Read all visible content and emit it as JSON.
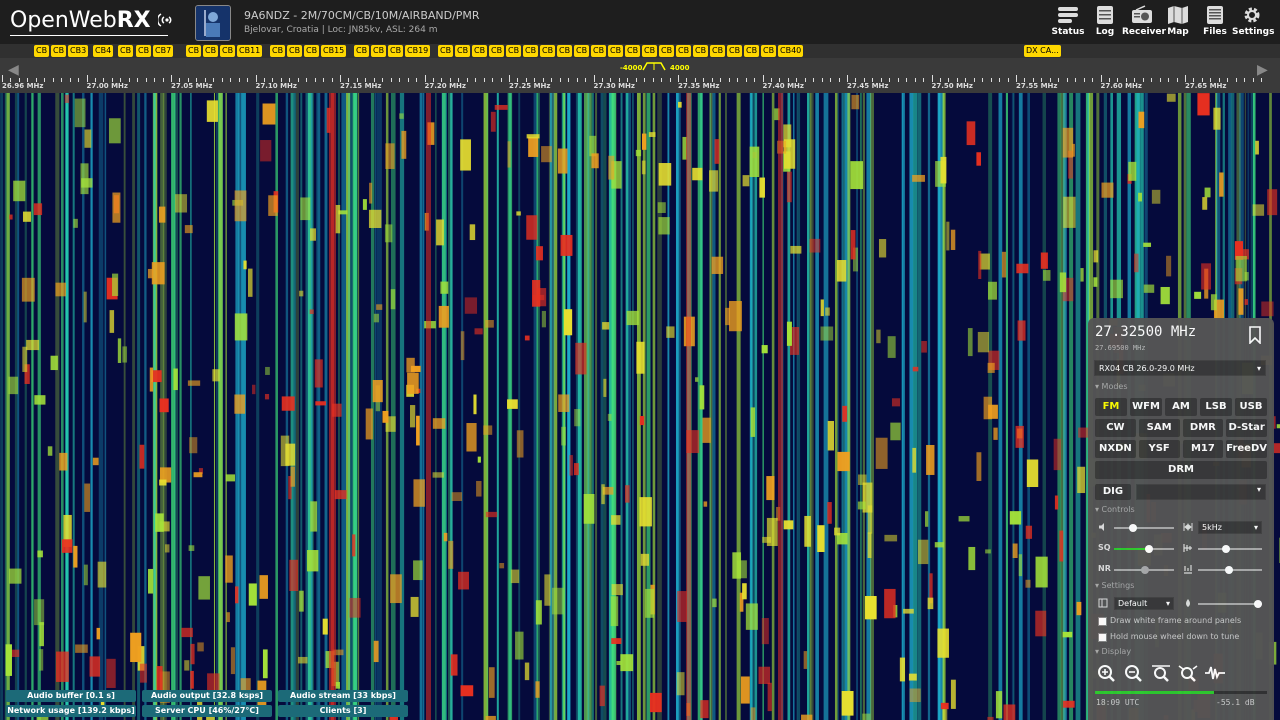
{
  "app": {
    "logo_light": "OpenWeb",
    "logo_bold": "RX"
  },
  "receiver": {
    "title": "9A6NDZ - 2M/70CM/CB/10M/AIRBAND/PMR",
    "subtitle": "Bjelovar, Croatia | Loc: JN85kv, ASL: 264 m"
  },
  "nav": [
    {
      "label": "Status",
      "icon": "status-icon"
    },
    {
      "label": "Log",
      "icon": "log-icon"
    },
    {
      "label": "Receiver",
      "icon": "receiver-icon"
    },
    {
      "label": "Map",
      "icon": "map-icon"
    },
    {
      "label": "Files",
      "icon": "files-icon"
    },
    {
      "label": "Settings",
      "icon": "gear-icon"
    }
  ],
  "bookmarks": [
    "CB",
    "CB",
    "CB3",
    "CB4",
    "CB",
    "CB",
    "CB7",
    "CB",
    "CB",
    "CB",
    "CB11",
    "CB",
    "CB",
    "CB",
    "CB15",
    "CB",
    "CB",
    "CB",
    "CB19",
    "CB",
    "CB",
    "CB",
    "CB",
    "CB",
    "CB",
    "CB",
    "CB",
    "CB",
    "CB",
    "CB",
    "CB",
    "CB",
    "CB",
    "CB",
    "CB",
    "CB",
    "CB",
    "CB",
    "CB",
    "CB40",
    "DX CA..."
  ],
  "scale": {
    "labels": [
      "26.96 MHz",
      "27.00 MHz",
      "27.05 MHz",
      "27.10 MHz",
      "27.15 MHz",
      "27.20 MHz",
      "27.25 MHz",
      "27.30 MHz",
      "27.35 MHz",
      "27.40 MHz",
      "27.45 MHz",
      "27.50 MHz",
      "27.55 MHz",
      "27.60 MHz",
      "27.65 MHz"
    ],
    "passband_low": "-4000",
    "passband_high": "4000"
  },
  "stats": [
    {
      "label": "Audio buffer [0.1 s]"
    },
    {
      "label": "Audio output [32.8 ksps]"
    },
    {
      "label": "Audio stream [33 kbps]"
    },
    {
      "label": "Network usage [139.2 kbps]"
    },
    {
      "label": "Server CPU [46%/27°C]"
    },
    {
      "label": "Clients [3]"
    }
  ],
  "panel": {
    "frequency": "27.32500 MHz",
    "sub_frequency": "27.69500 MHz",
    "profile": "RX04 CB 26.0-29.0 MHz",
    "modes_label": "▾ Modes",
    "modes": [
      [
        "FM",
        "WFM",
        "AM",
        "LSB",
        "USB"
      ],
      [
        "CW",
        "SAM",
        "DMR",
        "D-Star"
      ],
      [
        "NXDN",
        "YSF",
        "M17",
        "FreeDV"
      ],
      [
        "DRM"
      ]
    ],
    "active_mode": "FM",
    "dig_label": "DIG",
    "controls_label": "▾ Controls",
    "step": "5kHz",
    "sq_label": "SQ",
    "nr_label": "NR",
    "settings_label": "▾ Settings",
    "theme": "Default",
    "check1": "Draw white frame around panels",
    "check2": "Hold mouse wheel down to tune",
    "display_label": "▾ Display",
    "clock": "18:09 UTC",
    "level": "-55.1 dB",
    "audio_level": 0.69
  }
}
